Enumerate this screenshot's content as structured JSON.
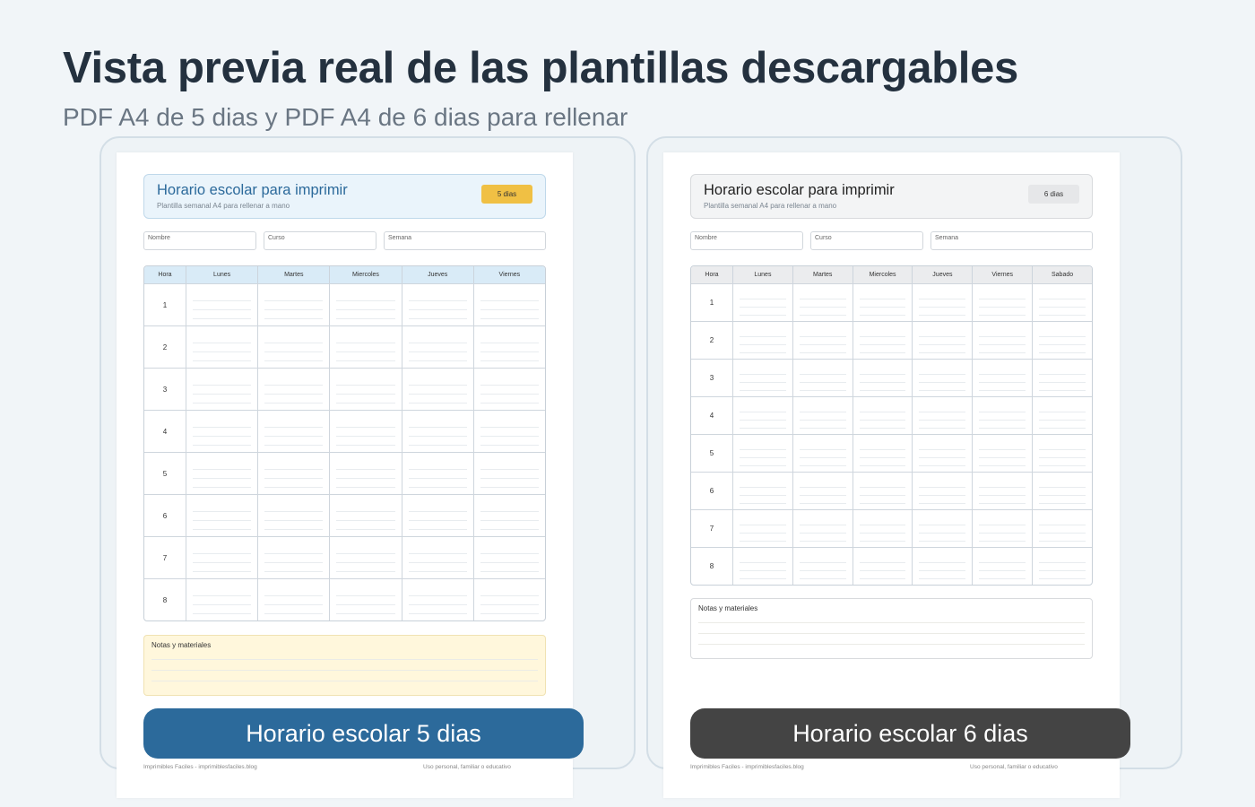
{
  "page": {
    "title": "Vista previa real de las plantillas descargables",
    "subtitle": "PDF A4 de 5 dias y PDF A4 de 6 dias para rellenar"
  },
  "previews": [
    {
      "title": "Horario escolar para imprimir",
      "subtitle": "Plantilla semanal A4 para rellenar a mano",
      "badge": "5 dias",
      "fields": [
        "Nombre",
        "Curso",
        "Semana"
      ],
      "header_col": "Hora",
      "days": [
        "Lunes",
        "Martes",
        "Miercoles",
        "Jueves",
        "Viernes"
      ],
      "hours": [
        "1",
        "2",
        "3",
        "4",
        "5",
        "6",
        "7",
        "8"
      ],
      "notes_label": "Notas y materiales",
      "footer_left": "Imprimibles Faciles - imprimiblesfaciles.blog",
      "footer_right": "Uso personal, familiar o educativo",
      "button_label": "Horario escolar 5 dias",
      "accent": "#2c6a9b",
      "badge_color": "#f0c044",
      "notes_color": "#fff7dc"
    },
    {
      "title": "Horario escolar para imprimir",
      "subtitle": "Plantilla semanal A4 para rellenar a mano",
      "badge": "6 dias",
      "fields": [
        "Nombre",
        "Curso",
        "Semana"
      ],
      "header_col": "Hora",
      "days": [
        "Lunes",
        "Martes",
        "Miercoles",
        "Jueves",
        "Viernes",
        "Sabado"
      ],
      "hours": [
        "1",
        "2",
        "3",
        "4",
        "5",
        "6",
        "7",
        "8"
      ],
      "notes_label": "Notas y materiales",
      "footer_left": "Imprimibles Faciles - imprimiblesfaciles.blog",
      "footer_right": "Uso personal, familiar o educativo",
      "button_label": "Horario escolar 6 dias",
      "accent": "#444444",
      "badge_color": "#e6e7e9",
      "notes_color": "#ffffff"
    }
  ]
}
